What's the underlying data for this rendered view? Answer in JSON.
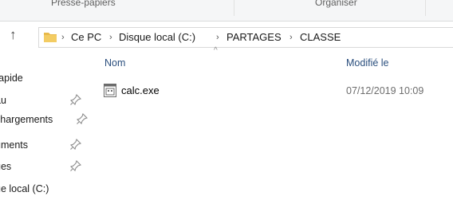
{
  "ribbon": {
    "group_clipboard": "Presse-papiers",
    "group_organize": "Organiser"
  },
  "address_bar": {
    "up_icon": "arrow-up-icon",
    "folder_icon": "folder-icon",
    "crumbs": [
      "Ce PC",
      "Disque local (C:)",
      "PARTAGES",
      "CLASSE"
    ]
  },
  "nav_pane": {
    "items": [
      {
        "label": "rapide",
        "pinned": false
      },
      {
        "label": "au",
        "pinned": true
      },
      {
        "label": "chargements",
        "pinned": true
      },
      {
        "label": "uments",
        "pinned": true
      },
      {
        "label": "ges",
        "pinned": true
      },
      {
        "label": "ue local (C:)",
        "pinned": false
      }
    ]
  },
  "file_list": {
    "col_name": "Nom",
    "col_modified": "Modifié le",
    "files": [
      {
        "name": "calc.exe",
        "modified": "07/12/2019 10:09",
        "icon": "exe-file-icon"
      }
    ]
  },
  "colors": {
    "header_text": "#2b4f7e",
    "folder": "#e8b94a"
  }
}
